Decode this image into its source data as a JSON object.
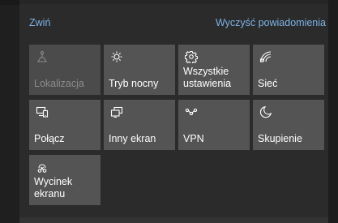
{
  "header": {
    "collapse_label": "Zwiń",
    "clear_label": "Wyczyść powiadomienia"
  },
  "tiles": [
    {
      "label": "Lokalizacja",
      "icon": "location-icon",
      "enabled": false
    },
    {
      "label": "Tryb nocny",
      "icon": "sun-icon",
      "enabled": true
    },
    {
      "label": "Wszystkie ustawienia",
      "icon": "gear-icon",
      "enabled": true
    },
    {
      "label": "Sieć",
      "icon": "network-icon",
      "enabled": true
    },
    {
      "label": "Połącz",
      "icon": "connect-icon",
      "enabled": true
    },
    {
      "label": "Inny ekran",
      "icon": "project-icon",
      "enabled": true
    },
    {
      "label": "VPN",
      "icon": "vpn-icon",
      "enabled": true
    },
    {
      "label": "Skupienie",
      "icon": "moon-icon",
      "enabled": true
    },
    {
      "label": "Wycinek ekranu",
      "icon": "snip-icon",
      "enabled": true
    }
  ],
  "colors": {
    "accent_link": "#7bb3e6",
    "tile_bg": "#545454",
    "panel_bg": "#2b2b2b"
  }
}
